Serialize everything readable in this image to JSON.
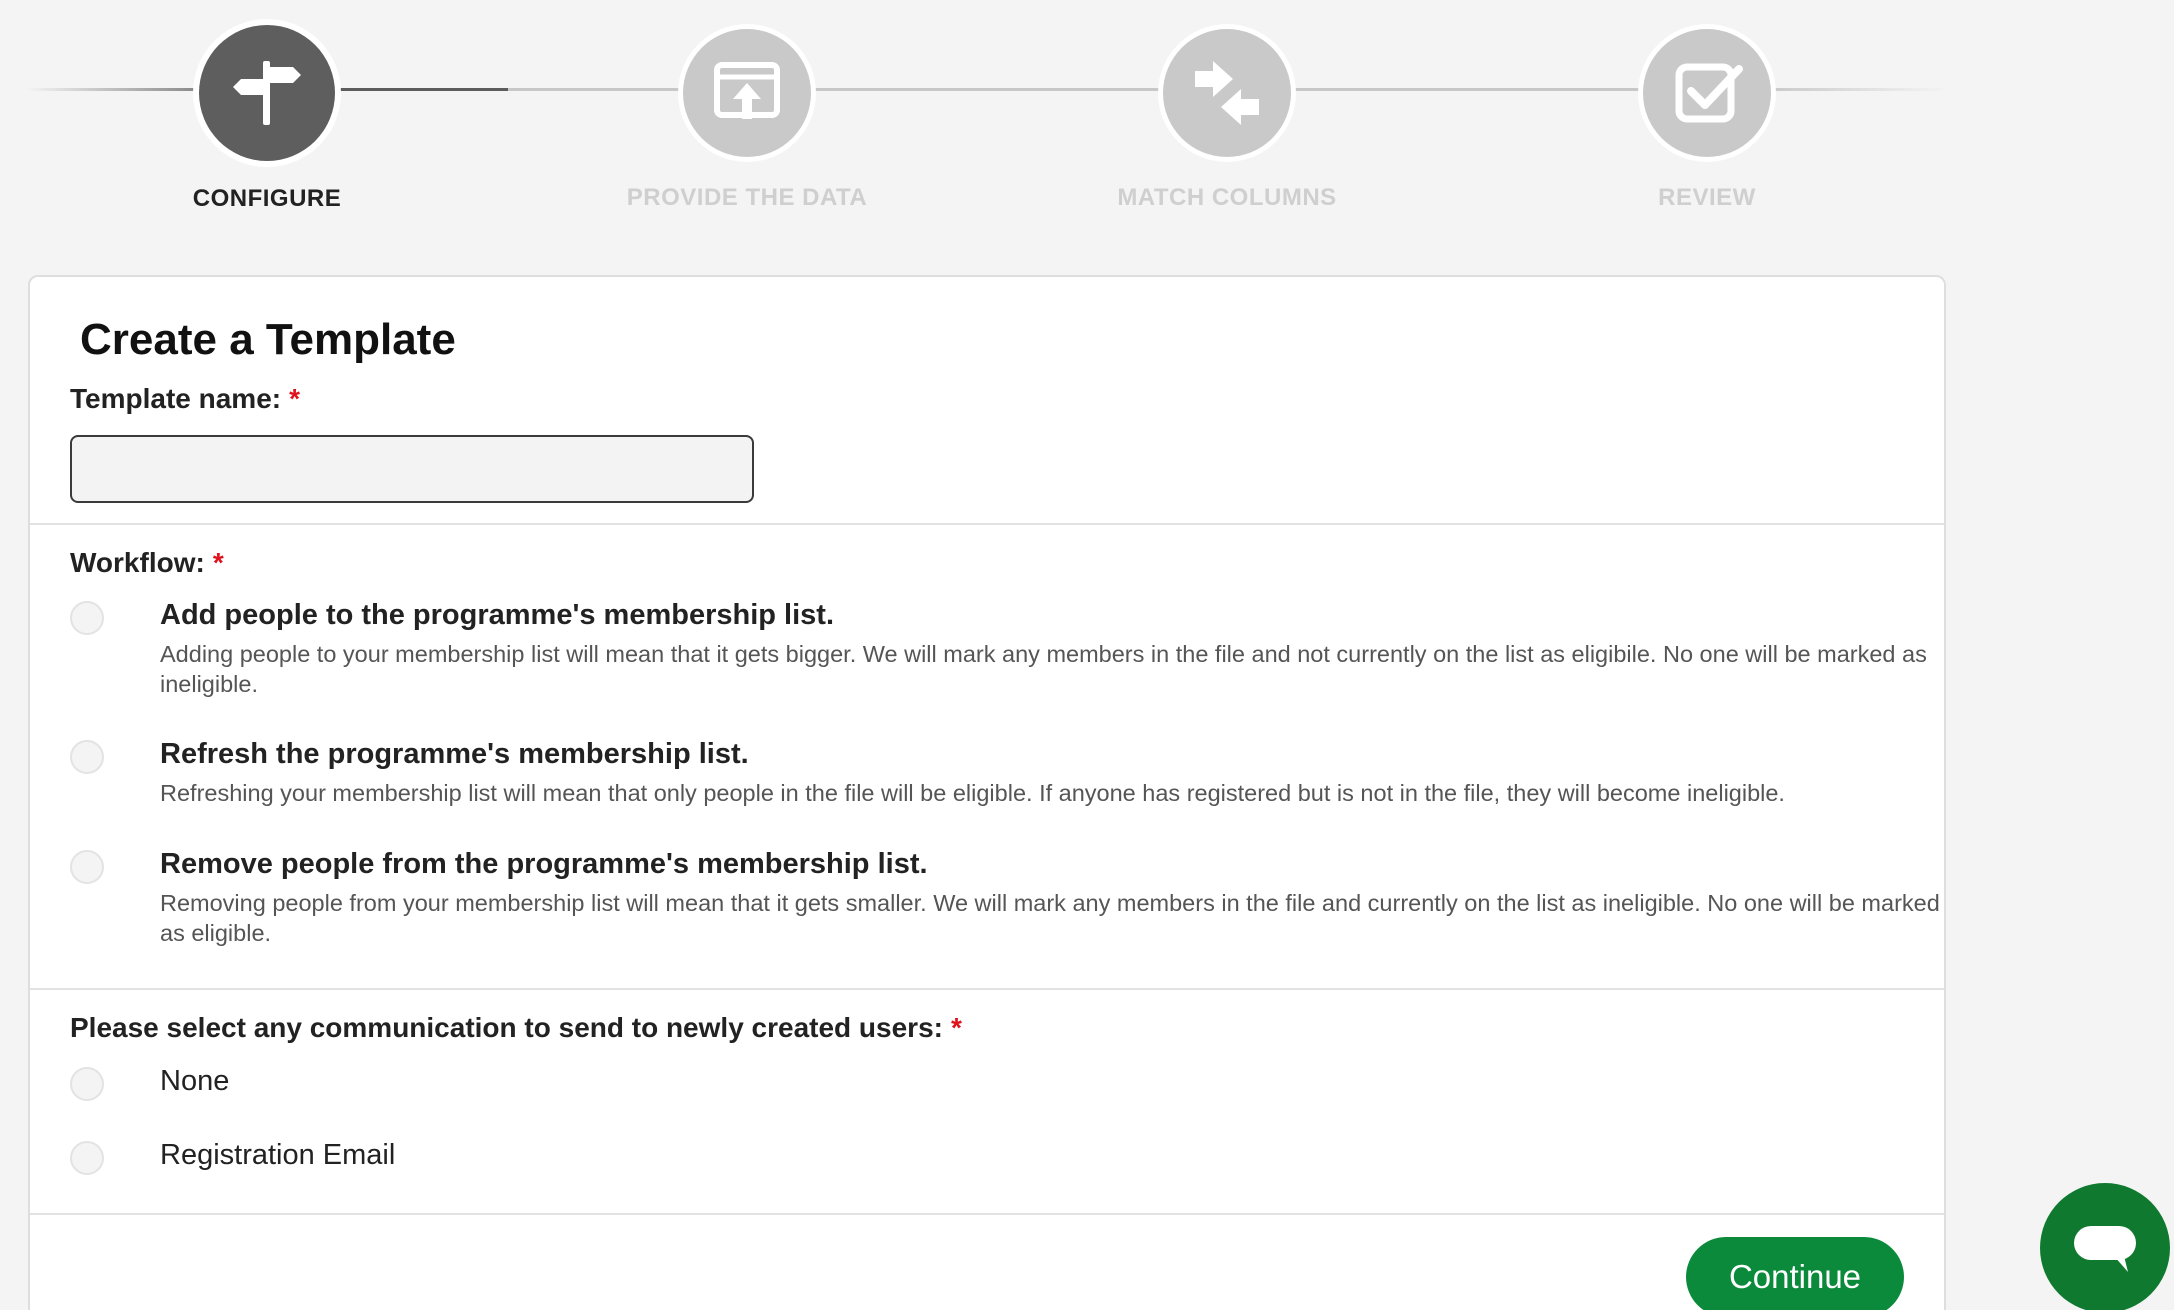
{
  "stepper": {
    "steps": [
      {
        "label": "CONFIGURE",
        "icon": "signpost-icon",
        "state": "active"
      },
      {
        "label": "PROVIDE THE DATA",
        "icon": "upload-window-icon",
        "state": "inactive"
      },
      {
        "label": "MATCH COLUMNS",
        "icon": "swap-arrows-icon",
        "state": "inactive"
      },
      {
        "label": "REVIEW",
        "icon": "checkbox-icon",
        "state": "inactive"
      }
    ]
  },
  "form": {
    "title": "Create a Template",
    "template_name": {
      "label": "Template name:",
      "required_mark": "*",
      "value": "",
      "placeholder": ""
    },
    "workflow": {
      "label": "Workflow:",
      "required_mark": "*",
      "options": [
        {
          "title": "Add people to the programme's membership list.",
          "description": "Adding people to your membership list will mean that it gets bigger. We will mark any members in the file and not currently on the list as eligibile. No one will be marked as ineligible.",
          "selected": false
        },
        {
          "title": "Refresh the programme's membership list.",
          "description": "Refreshing your membership list will mean that only people in the file will be eligible. If anyone has registered but is not in the file, they will become ineligible.",
          "selected": false
        },
        {
          "title": "Remove people from the programme's membership list.",
          "description": "Removing people from your membership list will mean that it gets smaller. We will mark any members in the file and currently on the list as ineligible. No one will be marked as eligible.",
          "selected": false
        }
      ]
    },
    "communication": {
      "label": "Please select any communication to send to newly created users:",
      "required_mark": "*",
      "options": [
        {
          "label": "None",
          "selected": false
        },
        {
          "label": "Registration Email",
          "selected": false
        }
      ]
    },
    "continue_label": "Continue"
  },
  "colors": {
    "active_step": "#5e5e5e",
    "inactive_step": "#c9c9c9",
    "required": "#e0121b",
    "primary_button": "#0c8a3c",
    "chat_button": "#0f7a2f"
  },
  "chat": {
    "icon": "chat-bubble-icon"
  }
}
